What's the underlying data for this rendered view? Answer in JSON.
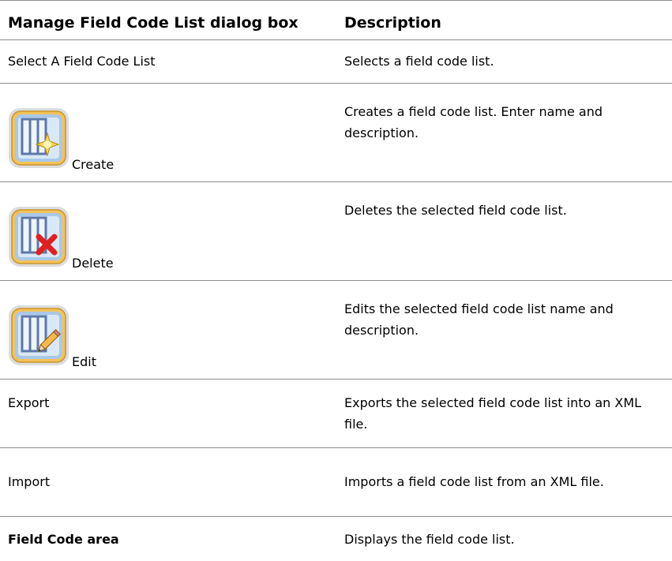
{
  "table": {
    "header": {
      "left": "Manage Field Code List dialog box",
      "right": "Description"
    },
    "rows": [
      {
        "left": "Select A Field Code List",
        "right": "Selects a field code list."
      },
      {
        "icon": "create-list-icon",
        "left": "Create",
        "right": "Creates a field code list. Enter name and description."
      },
      {
        "icon": "delete-list-icon",
        "left": "Delete",
        "right": "Deletes the selected field code list."
      },
      {
        "icon": "edit-list-icon",
        "left": "Edit",
        "right": "Edits the selected field code list name and description."
      },
      {
        "left": "Export",
        "right": "Exports the selected field code list into an XML file."
      },
      {
        "left": "Import",
        "right": "Imports a field code list from an XML file."
      },
      {
        "left": "Field Code area",
        "right": "Displays the field code list."
      }
    ]
  },
  "colors": {
    "rule": "#8c8c8c",
    "icon_frame": "#f2c25a",
    "icon_blue": "#5d78a8",
    "delete_red": "#e02020"
  }
}
